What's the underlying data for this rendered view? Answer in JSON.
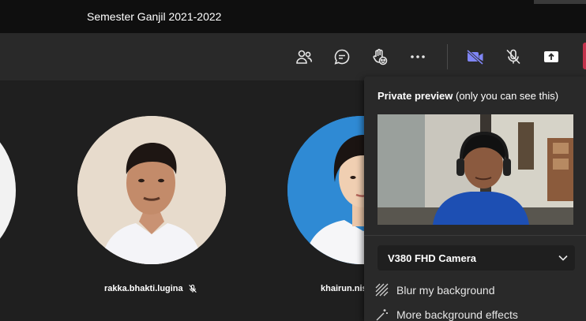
{
  "window": {
    "title": "Semester Ganjil 2021-2022"
  },
  "toolbar": {
    "icons": [
      "people-icon",
      "chat-icon",
      "raise-hand-icon",
      "more-icon",
      "camera-icon",
      "mic-off-icon",
      "share-icon"
    ]
  },
  "participants": [
    {
      "name": "rakka.bhakti.lugina",
      "muted": true
    },
    {
      "name": "khairun.nis"
    }
  ],
  "preview_panel": {
    "title_bold": "Private preview",
    "title_rest": " (only you can see this)",
    "camera_select": {
      "value": "V380 FHD Camera"
    },
    "options": [
      "Blur my background",
      "More background effects"
    ]
  },
  "colors": {
    "accent": "#7f85f5",
    "leave": "#c4314b",
    "bg": "#1f1f1f",
    "panel": "#292929"
  }
}
